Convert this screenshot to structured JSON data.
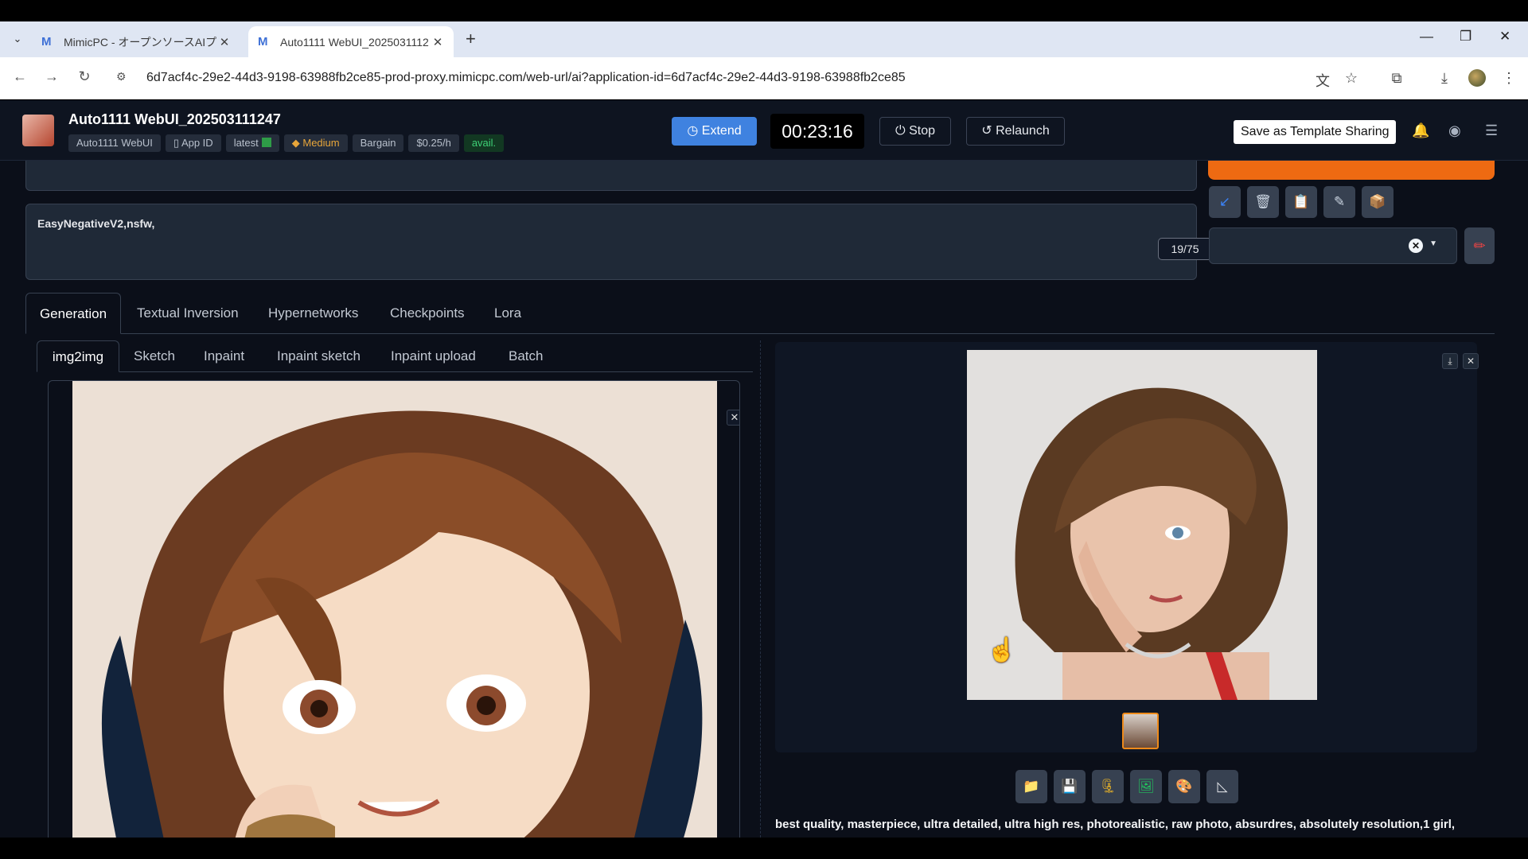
{
  "browser": {
    "tabs": [
      {
        "title": "MimicPC - オープンソースAIプラット",
        "active": false
      },
      {
        "title": "Auto1111 WebUI_2025031112",
        "active": true
      }
    ],
    "url": "6d7acf4c-29e2-44d3-9198-63988fb2ce85-prod-proxy.mimicpc.com/web-url/ai?application-id=6d7acf4c-29e2-44d3-9198-63988fb2ce85"
  },
  "header": {
    "title": "Auto1111 WebUI_202503111247",
    "chips": {
      "app": "Auto1111 WebUI",
      "app_id": "App ID",
      "version": "latest",
      "tier": "Medium",
      "bargain": "Bargain",
      "price": "$0.25/h",
      "status": "avail."
    },
    "extend_label": "Extend",
    "timer": "00:23:16",
    "stop_label": "Stop",
    "relaunch_label": "Relaunch",
    "template_label": "Save as Template Sharing"
  },
  "prompts": {
    "negative": "EasyNegativeV2,nsfw,",
    "token_count": "19/75"
  },
  "main_tabs": [
    "Generation",
    "Textual Inversion",
    "Hypernetworks",
    "Checkpoints",
    "Lora"
  ],
  "sub_tabs": [
    "img2img",
    "Sketch",
    "Inpaint",
    "Inpaint sketch",
    "Inpaint upload",
    "Batch"
  ],
  "output": {
    "prompt": "best quality, masterpiece, ultra detailed, ultra high res, photorealistic, raw photo, absurdres, absolutely resolution,1 girl,"
  },
  "colors": {
    "accent_orange": "#ee6a12",
    "extend_blue": "#3f82e0",
    "bg": "#0b0f19"
  }
}
